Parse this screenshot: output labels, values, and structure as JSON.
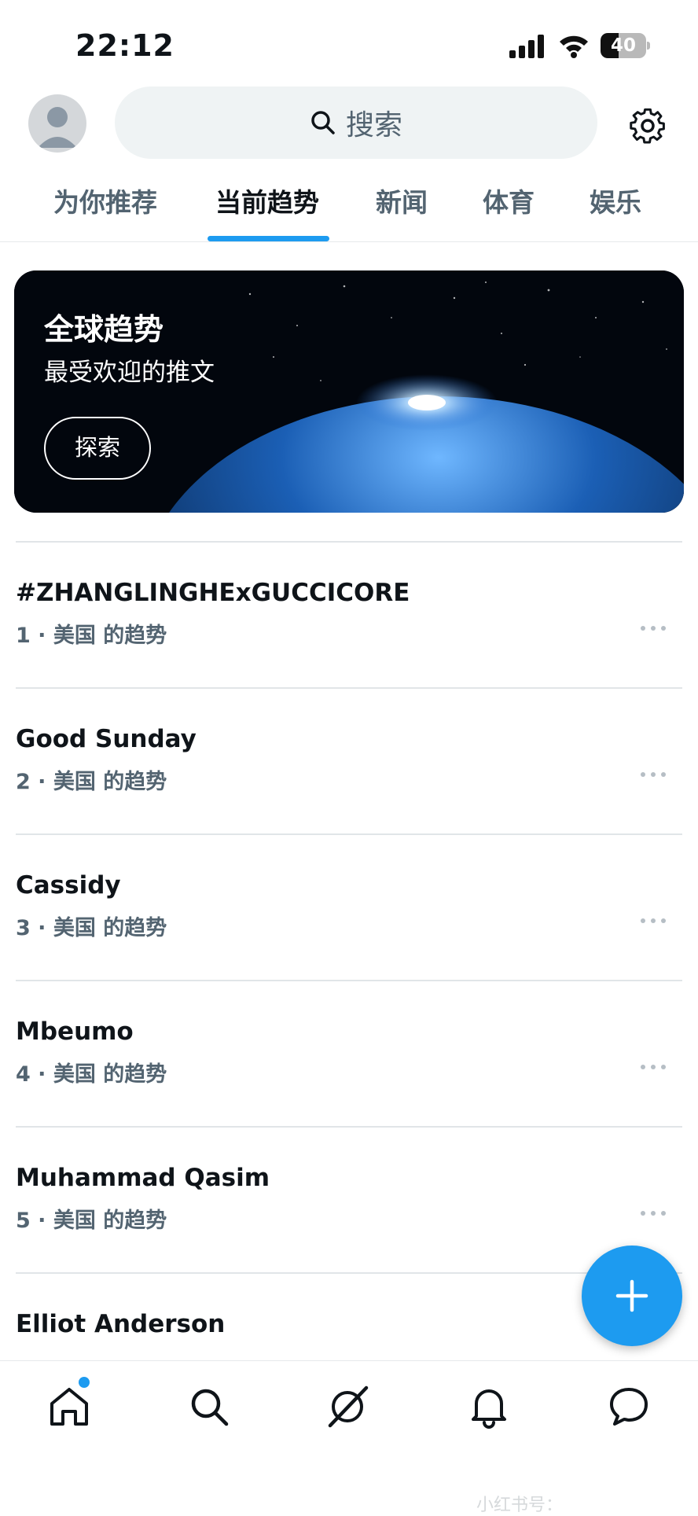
{
  "status_bar": {
    "time": "22:12",
    "battery_level": "40",
    "battery_fraction": 0.4
  },
  "search": {
    "label": "搜索"
  },
  "tabs": [
    {
      "label": "为你推荐",
      "active": false
    },
    {
      "label": "当前趋势",
      "active": true
    },
    {
      "label": "新闻",
      "active": false
    },
    {
      "label": "体育",
      "active": false
    },
    {
      "label": "娱乐",
      "active": false
    }
  ],
  "banner": {
    "title": "全球趋势",
    "subtitle": "最受欢迎的推文",
    "button": "探索"
  },
  "trends": [
    {
      "title": "#ZHANGLINGHExGUCCICORE",
      "meta": "1 · 美国 的趋势"
    },
    {
      "title": "Good Sunday",
      "meta": "2 · 美国 的趋势"
    },
    {
      "title": "Cassidy",
      "meta": "3 · 美国 的趋势"
    },
    {
      "title": "Mbeumo",
      "meta": "4 · 美国 的趋势"
    },
    {
      "title": "Muhammad Qasim",
      "meta": "5 · 美国 的趋势"
    },
    {
      "title": "Elliot Anderson",
      "meta": ""
    }
  ],
  "watermark": "小红书号：",
  "colors": {
    "accent": "#1d9bf0",
    "text": "#0f1419",
    "secondary": "#536471",
    "search_bg": "#eff3f4"
  },
  "icons": {
    "bottom_nav": [
      "home-icon",
      "search-icon",
      "grok-icon",
      "notifications-icon",
      "messages-icon"
    ],
    "header": [
      "avatar",
      "search-icon",
      "gear-icon"
    ]
  }
}
